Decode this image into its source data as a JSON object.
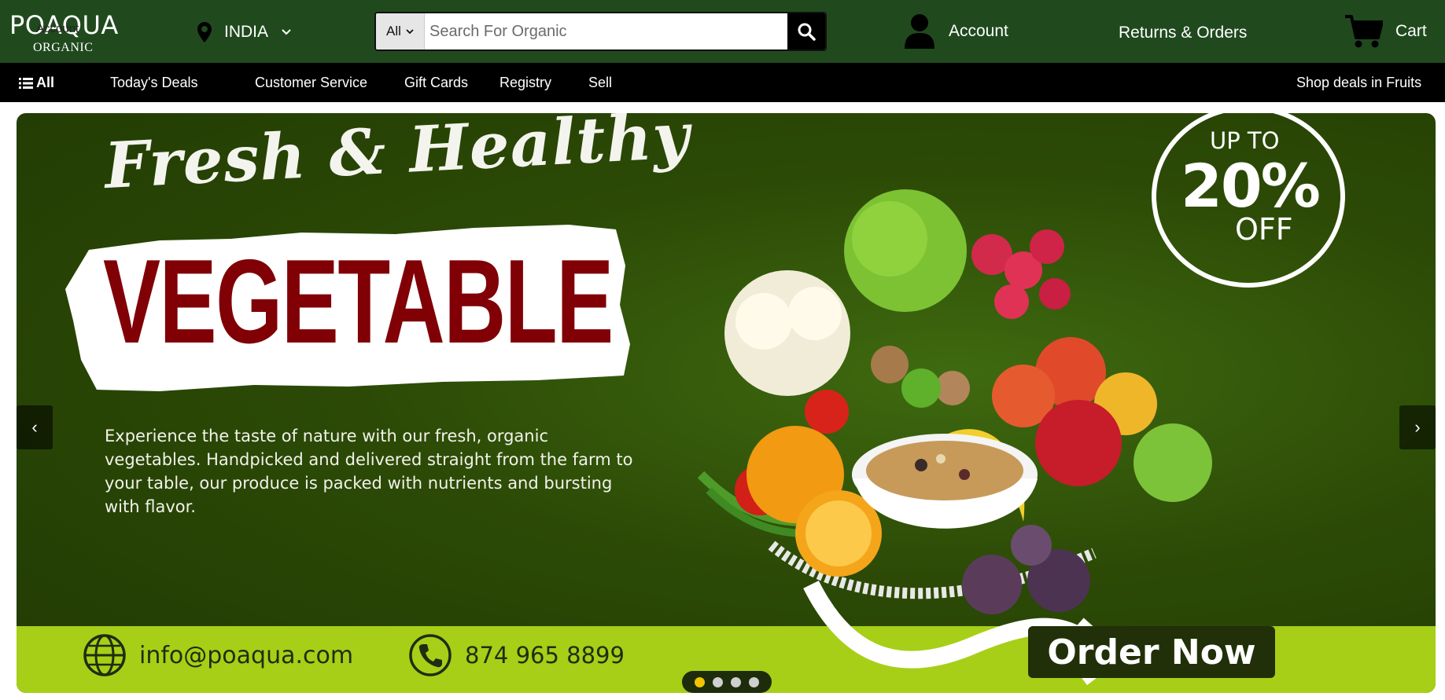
{
  "colors": {
    "header_bg": "#204a1e",
    "nav_bg": "#000000",
    "hero_bg": "#2c4a06",
    "hero_bottom_bg": "#a7cf17",
    "vegetable_text": "#800006",
    "order_button_bg": "#213008",
    "dot_active": "#f2c500"
  },
  "header": {
    "logo_text": "POAQUA",
    "logo_subtext": "ORGANIC",
    "logo_overlay_text": "Account",
    "location": {
      "icon": "location-pin-icon",
      "country": "INDIA",
      "chevron_icon": "chevron-down-icon"
    },
    "search": {
      "category_selected": "All",
      "placeholder": "Search For Organic",
      "value": "",
      "button_icon": "search-icon"
    },
    "account": {
      "icon": "person-icon",
      "label": "Account"
    },
    "returns_label": "Returns & Orders",
    "cart": {
      "icon": "cart-icon",
      "label": "Cart"
    }
  },
  "nav": {
    "all": {
      "icon": "hamburger-icon",
      "label": "All"
    },
    "items": [
      "Today's Deals",
      "Customer Service",
      "Gift Cards",
      "Registry",
      "Sell"
    ],
    "right_label": "Shop deals in Fruits"
  },
  "hero": {
    "script_title": "Fresh & Healthy",
    "headline": "VEGETABLE",
    "description": "Experience the taste of nature with our fresh, organic vegetables. Handpicked and delivered straight from the farm to your table, our produce is packed with nutrients and bursting with flavor.",
    "badge": {
      "up_to": "UP TO",
      "percent": "20%",
      "off": "OFF"
    },
    "prev_label": "‹",
    "next_label": "›",
    "email": {
      "icon": "globe-icon",
      "text": "info@poaqua.com"
    },
    "phone": {
      "icon": "phone-icon",
      "text": "874 965 8899"
    },
    "order_button": "Order Now",
    "slides_total": 4,
    "active_slide": 1
  }
}
